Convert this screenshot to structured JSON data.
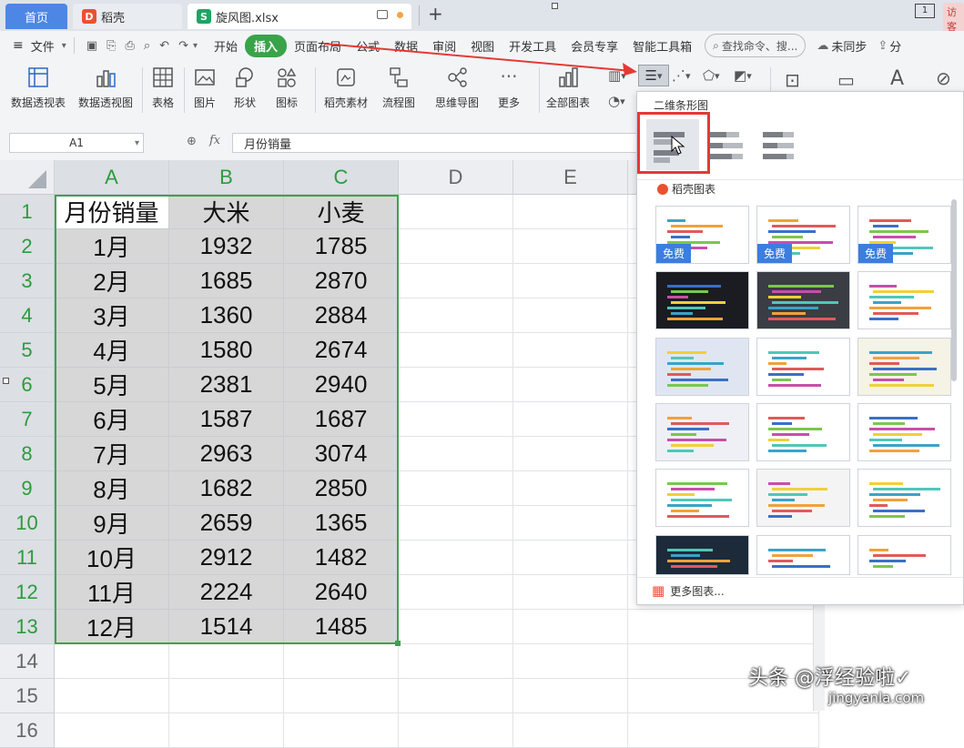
{
  "tabs": {
    "home": "首页",
    "doc": "稻壳",
    "active_file": "旋风图.xlsx",
    "add": "+",
    "right_edge": "访客"
  },
  "menu": {
    "file": "文件",
    "items": [
      "开始",
      "插入",
      "页面布局",
      "公式",
      "数据",
      "审阅",
      "视图",
      "开发工具",
      "会员专享",
      "智能工具箱"
    ],
    "active": "插入",
    "search": "查找命令、搜...",
    "sync": "未同步",
    "share": "分"
  },
  "ribbon": {
    "pivot_table": "数据透视表",
    "pivot_chart": "数据透视图",
    "table": "表格",
    "picture": "图片",
    "shape": "形状",
    "icon": "图标",
    "docer_material": "稻壳素材",
    "flowchart": "流程图",
    "mindmap": "思维导图",
    "more": "更多",
    "all_charts": "全部图表"
  },
  "formula_bar": {
    "cell_ref": "A1",
    "fx": "fx",
    "content": "月份销量"
  },
  "sheet": {
    "columns": [
      "A",
      "B",
      "C",
      "D",
      "E"
    ],
    "row_numbers": [
      "1",
      "2",
      "3",
      "4",
      "5",
      "6",
      "7",
      "8",
      "9",
      "10",
      "11",
      "12",
      "13",
      "14",
      "15",
      "16"
    ],
    "header": [
      "月份销量",
      "大米",
      "小麦"
    ],
    "rows": [
      [
        "1月",
        "1932",
        "1785"
      ],
      [
        "2月",
        "1685",
        "2870"
      ],
      [
        "3月",
        "1360",
        "2884"
      ],
      [
        "4月",
        "1580",
        "2674"
      ],
      [
        "5月",
        "2381",
        "2940"
      ],
      [
        "6月",
        "1587",
        "1687"
      ],
      [
        "7月",
        "2963",
        "3074"
      ],
      [
        "8月",
        "1682",
        "2850"
      ],
      [
        "9月",
        "2659",
        "1365"
      ],
      [
        "10月",
        "2912",
        "1482"
      ],
      [
        "11月",
        "2224",
        "2640"
      ],
      [
        "12月",
        "1514",
        "1485"
      ]
    ]
  },
  "chart_panel": {
    "section_title": "二维条形图",
    "docer_title": "稻壳图表",
    "free_label": "免费",
    "more_charts": "更多图表..."
  },
  "watermark": {
    "line1": "头条 @浮经验啦✓",
    "line2": "jingyanla.com"
  },
  "colors": {
    "accent_green": "#3aa34a",
    "selection_green": "#2e9a3e",
    "home_tab": "#4e86e6",
    "highlight_red": "#e53935",
    "free_badge": "#3b7de0"
  }
}
